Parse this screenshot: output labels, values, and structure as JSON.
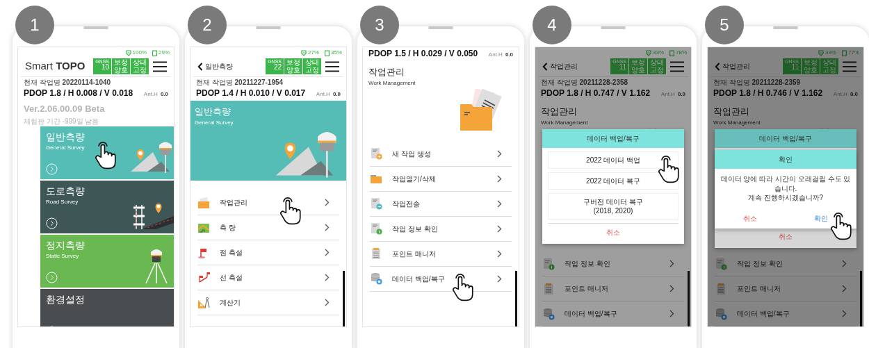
{
  "steps": [
    {
      "number": "1",
      "screen": {
        "status": {
          "signal": "100%",
          "battery": "29%"
        },
        "header": {
          "kind": "logo",
          "title": "Smart **TOPO**",
          "gnss": {
            "labels": [
              "GNSS",
              "보정",
              "상태"
            ],
            "values": [
              "10",
              "양호",
              "고정"
            ]
          }
        },
        "job": "현재 작업명 **20220114-1040**",
        "pdop": "PDOP 1.8 / H 0.008 / V 0.018",
        "ant_label": "Ant.H",
        "ant_value": "0.0",
        "version": "Ver.2.06.00.09 Beta",
        "trial": "체험판 기간 -999일 남음",
        "cards": [
          {
            "kind": "general",
            "title": "일반측량",
            "subtitle": "General Survey",
            "color": "#55bdb5",
            "touched": true
          },
          {
            "kind": "road",
            "title": "도로측량",
            "subtitle": "Road Survey",
            "color": "#3f5657",
            "touched": false
          },
          {
            "kind": "static",
            "title": "정지측량",
            "subtitle": "Static Survey",
            "color": "#6ab852",
            "touched": false
          },
          {
            "kind": "settings",
            "title": "환경설정",
            "color": "#4a4d4f",
            "touched": false
          }
        ]
      }
    },
    {
      "number": "2",
      "screen": {
        "status": {
          "signal": "27%",
          "battery": "35%"
        },
        "header": {
          "kind": "back",
          "title": "일반측량",
          "gnss": {
            "labels": [
              "GNSS",
              "보정",
              "상태"
            ],
            "values": [
              "22",
              "양호",
              "고정"
            ]
          }
        },
        "job": "현재 작업명 **20211227-1954**",
        "pdop": "PDOP 1.4 / H 0.010 / V 0.017",
        "ant_label": "Ant.H",
        "ant_value": "0.0",
        "banner": {
          "title": "일반측량",
          "subtitle": "General Survey"
        },
        "rows": [
          {
            "kind": "folder",
            "label": "작업관리",
            "touched": true
          },
          {
            "kind": "map",
            "label": "측 량",
            "touched": false
          },
          {
            "kind": "flag",
            "label": "점 측설",
            "touched": false
          },
          {
            "kind": "flags",
            "label": "선 측설",
            "touched": false
          },
          {
            "kind": "ruler",
            "label": "계산기",
            "touched": false
          }
        ]
      }
    },
    {
      "number": "3",
      "screen": {
        "pdop": "PDOP 1.5 / H 0.029 / V 0.050",
        "ant_label": "Ant.H",
        "ant_value": "0.0",
        "section": {
          "title": "작업관리",
          "subtitle": "Work Management"
        },
        "rows": [
          {
            "kind": "new",
            "label": "새 작업 생성",
            "touched": false
          },
          {
            "kind": "open",
            "label": "작업열기/삭제",
            "touched": false
          },
          {
            "kind": "send",
            "label": "작업전송",
            "touched": false
          },
          {
            "kind": "info",
            "label": "작업 정보 확인",
            "touched": false
          },
          {
            "kind": "points",
            "label": "포인트 매니저",
            "touched": false
          },
          {
            "kind": "backup",
            "label": "데이터 백업/복구",
            "touched": true
          }
        ]
      }
    },
    {
      "number": "4",
      "screen": {
        "status": {
          "signal": "33%",
          "battery": "78%"
        },
        "header": {
          "kind": "back",
          "title": "작업관리",
          "gnss": {
            "labels": [
              "GNSS",
              "보정",
              "상태"
            ],
            "values": [
              "11",
              "양호",
              "고정"
            ]
          }
        },
        "job": "현재 작업명 **20211228-2358**",
        "pdop": "PDOP 1.8 / H 0.747 / V 1.162",
        "ant_label": "Ant.H",
        "ant_value": "0.0",
        "section": {
          "title": "작업관리",
          "subtitle": "Work Management"
        },
        "rows": [
          {
            "kind": "info",
            "label": "작업 정보 확인",
            "touched": false
          },
          {
            "kind": "points",
            "label": "포인트 매니저",
            "touched": false
          },
          {
            "kind": "backup",
            "label": "데이터 백업/복구",
            "touched": false
          }
        ],
        "dialogs": [
          {
            "kind": "choice",
            "title": "데이터 백업/복구",
            "options": [
              {
                "label": "2022 데이터 백업",
                "touched": true
              },
              {
                "label": "2022 데이터 복구",
                "touched": false
              },
              {
                "label": "구버전 데이터 복구\n(2018, 2020)",
                "touched": false
              }
            ],
            "cancel": "취소"
          }
        ]
      }
    },
    {
      "number": "5",
      "screen": {
        "status": {
          "signal": "33%",
          "battery": "77%"
        },
        "header": {
          "kind": "back",
          "title": "작업관리",
          "gnss": {
            "labels": [
              "GNSS",
              "보정",
              "상태"
            ],
            "values": [
              "11",
              "양호",
              "고정"
            ]
          }
        },
        "job": "현재 작업명 **20211228-2359**",
        "pdop": "PDOP 1.8 / H 0.746 / V 1.162",
        "ant_label": "Ant.H",
        "ant_value": "0.0",
        "section": {
          "title": "작업관리",
          "subtitle": "Work Management"
        },
        "rows": [
          {
            "kind": "info",
            "label": "작업 정보 확인",
            "touched": false
          },
          {
            "kind": "points",
            "label": "포인트 매니저",
            "touched": false
          },
          {
            "kind": "backup",
            "label": "데이터 백업/복구",
            "touched": false
          }
        ],
        "dialogs": [
          {
            "kind": "choice",
            "title": "데이터 백업/복구",
            "cancel": "취소"
          },
          {
            "kind": "confirm",
            "title": "확인",
            "message": "데이터 양에 따라 시간이 오래걸릴 수도 있습니다.\n계속 진행하시겠습니까?",
            "buttons": [
              {
                "kind": "cancel",
                "label": "취소",
                "touched": false
              },
              {
                "kind": "ok",
                "label": "확인",
                "touched": true
              }
            ]
          }
        ]
      }
    }
  ]
}
